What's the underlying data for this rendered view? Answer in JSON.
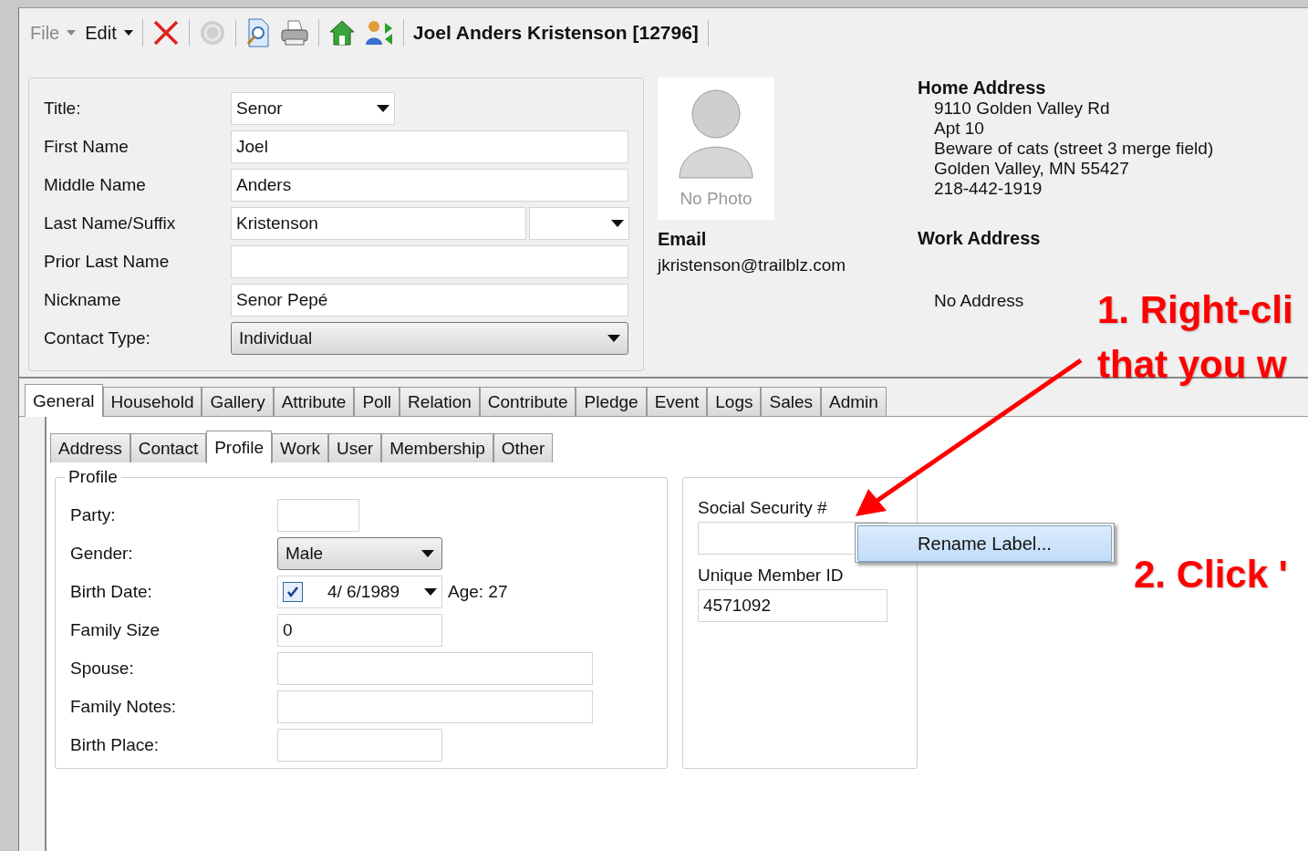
{
  "toolbar": {
    "menus": [
      {
        "label": "File",
        "disabled": true
      },
      {
        "label": "Edit",
        "disabled": false
      }
    ],
    "tools": [
      {
        "kind": "delete",
        "disabled": false
      },
      {
        "kind": "help",
        "disabled": true
      },
      {
        "kind": "preview",
        "disabled": false
      },
      {
        "kind": "print",
        "disabled": false
      },
      {
        "kind": "home",
        "disabled": false
      },
      {
        "kind": "swap",
        "disabled": false
      }
    ],
    "title": "Joel Anders Kristenson [12796]"
  },
  "contact_form": {
    "fields": [
      {
        "label": "Title:",
        "kind": "select",
        "value": "Senor"
      },
      {
        "label": "First Name",
        "kind": "text",
        "value": "Joel"
      },
      {
        "label": "Middle Name",
        "kind": "text",
        "value": "Anders"
      },
      {
        "label": "Last Name/Suffix",
        "kind": "text_suffix",
        "value": "Kristenson"
      },
      {
        "label": "Prior Last Name",
        "kind": "text"
      },
      {
        "label": "Nickname",
        "kind": "text",
        "value": "Senor Pepé"
      },
      {
        "label": "Contact Type:",
        "kind": "combo",
        "value": "Individual"
      }
    ]
  },
  "photo": {
    "caption": "No Photo"
  },
  "email": {
    "heading": "Email",
    "value": "jkristenson@trailblz.com"
  },
  "home_address": {
    "heading": "Home Address",
    "lines": [
      "9110 Golden Valley Rd",
      "Apt 10",
      "Beware of cats (street 3 merge field)",
      "Golden Valley, MN 55427",
      "218-442-1919"
    ]
  },
  "work_address": {
    "heading": "Work Address",
    "value": "No Address"
  },
  "tabs": [
    {
      "label": "General",
      "selected": true
    },
    {
      "label": "Household",
      "selected": false
    },
    {
      "label": "Gallery",
      "selected": false
    },
    {
      "label": "Attribute",
      "selected": false
    },
    {
      "label": "Poll",
      "selected": false
    },
    {
      "label": "Relation",
      "selected": false
    },
    {
      "label": "Contribute",
      "selected": false
    },
    {
      "label": "Pledge",
      "selected": false
    },
    {
      "label": "Event",
      "selected": false
    },
    {
      "label": "Logs",
      "selected": false
    },
    {
      "label": "Sales",
      "selected": false
    },
    {
      "label": "Admin",
      "selected": false
    }
  ],
  "subtabs": [
    {
      "label": "Address",
      "selected": false
    },
    {
      "label": "Contact",
      "selected": false
    },
    {
      "label": "Profile",
      "selected": true
    },
    {
      "label": "Work",
      "selected": false
    },
    {
      "label": "User",
      "selected": false
    },
    {
      "label": "Membership",
      "selected": false
    },
    {
      "label": "Other",
      "selected": false
    }
  ],
  "profile": {
    "legend": "Profile",
    "fields": [
      {
        "label": "Party:",
        "kind": "short"
      },
      {
        "label": "Gender:",
        "kind": "combo",
        "value": "Male"
      },
      {
        "label": "Birth Date:",
        "kind": "date",
        "value": "4/  6/1989",
        "checked": true,
        "note": "Age: 27"
      },
      {
        "label": "Family Size",
        "kind": "medium",
        "value": "0"
      },
      {
        "label": "Spouse:",
        "kind": "long"
      },
      {
        "label": "Family Notes:",
        "kind": "long"
      },
      {
        "label": "Birth Place:",
        "kind": "medium"
      }
    ]
  },
  "ids": {
    "fields": [
      {
        "label": "Social Security #"
      },
      {
        "label": "Unique Member ID",
        "value": "4571092"
      }
    ]
  },
  "context_menu": {
    "items": [
      "Rename Label..."
    ]
  },
  "annotations": [
    {
      "text": "1. Right-cli"
    },
    {
      "text": "that you w"
    },
    {
      "text": "2. Click '"
    }
  ]
}
